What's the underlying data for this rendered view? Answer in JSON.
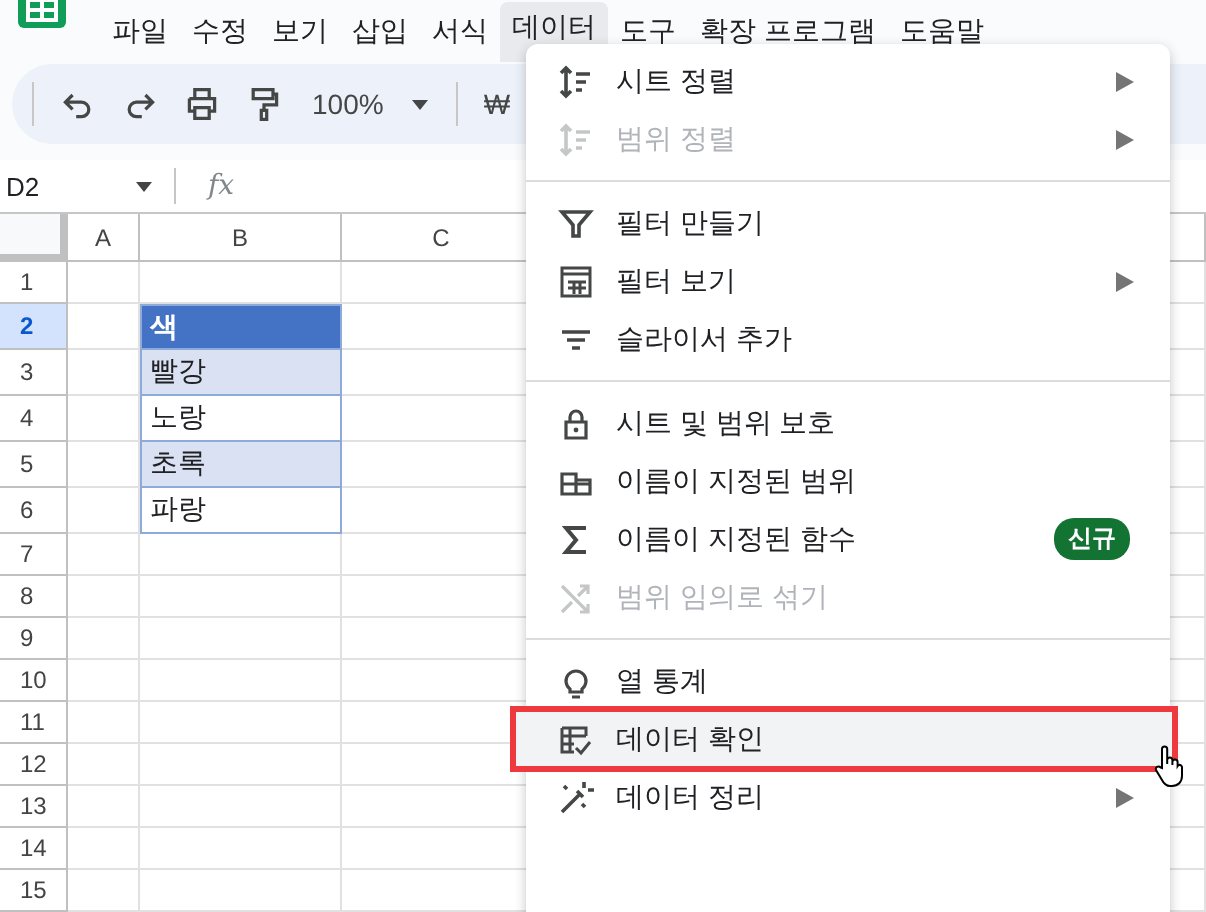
{
  "menu_bar": {
    "items": [
      {
        "label": "파일",
        "selected": false
      },
      {
        "label": "수정",
        "selected": false
      },
      {
        "label": "보기",
        "selected": false
      },
      {
        "label": "삽입",
        "selected": false
      },
      {
        "label": "서식",
        "selected": false
      },
      {
        "label": "데이터",
        "selected": true
      },
      {
        "label": "도구",
        "selected": false
      },
      {
        "label": "확장 프로그램",
        "selected": false
      },
      {
        "label": "도움말",
        "selected": false
      }
    ]
  },
  "toolbar": {
    "zoom": "100%",
    "currency": "₩"
  },
  "formula_bar": {
    "cell_ref": "D2",
    "fx": "fx"
  },
  "sheet": {
    "columns": [
      "A",
      "B",
      "C"
    ],
    "rows": [
      {
        "header": "1",
        "selected": false
      },
      {
        "header": "2",
        "selected": true,
        "b": {
          "text": "색",
          "kind": "header"
        }
      },
      {
        "header": "3",
        "selected": false,
        "b": {
          "text": "빨강",
          "kind": "band"
        }
      },
      {
        "header": "4",
        "selected": false,
        "b": {
          "text": "노랑",
          "kind": "plain"
        }
      },
      {
        "header": "5",
        "selected": false,
        "b": {
          "text": "초록",
          "kind": "band"
        }
      },
      {
        "header": "6",
        "selected": false,
        "b": {
          "text": "파랑",
          "kind": "plain"
        }
      },
      {
        "header": "7",
        "selected": false
      },
      {
        "header": "8",
        "selected": false
      },
      {
        "header": "9",
        "selected": false
      },
      {
        "header": "10",
        "selected": false
      },
      {
        "header": "11",
        "selected": false
      },
      {
        "header": "12",
        "selected": false
      },
      {
        "header": "13",
        "selected": false
      },
      {
        "header": "14",
        "selected": false
      },
      {
        "header": "15",
        "selected": false
      }
    ]
  },
  "data_menu": {
    "sections": [
      {
        "items": [
          {
            "label": "시트 정렬",
            "disabled": false,
            "submenu": true,
            "highlighted": false
          },
          {
            "label": "범위 정렬",
            "disabled": true,
            "submenu": true,
            "highlighted": false
          }
        ]
      },
      {
        "items": [
          {
            "label": "필터 만들기",
            "disabled": false,
            "submenu": false,
            "highlighted": false
          },
          {
            "label": "필터 보기",
            "disabled": false,
            "submenu": true,
            "highlighted": false
          },
          {
            "label": "슬라이서 추가",
            "disabled": false,
            "submenu": false,
            "highlighted": false
          }
        ]
      },
      {
        "items": [
          {
            "label": "시트 및 범위 보호",
            "disabled": false,
            "submenu": false,
            "highlighted": false
          },
          {
            "label": "이름이 지정된 범위",
            "disabled": false,
            "submenu": false,
            "highlighted": false
          },
          {
            "label": "이름이 지정된 함수",
            "disabled": false,
            "submenu": false,
            "highlighted": false,
            "badge": "신규"
          },
          {
            "label": "범위 임의로 섞기",
            "disabled": true,
            "submenu": false,
            "highlighted": false
          }
        ]
      },
      {
        "items": [
          {
            "label": "열 통계",
            "disabled": false,
            "submenu": false,
            "highlighted": false
          },
          {
            "label": "데이터 확인",
            "disabled": false,
            "submenu": false,
            "highlighted": true
          },
          {
            "label": "데이터 정리",
            "disabled": false,
            "submenu": true,
            "highlighted": false
          }
        ]
      }
    ]
  }
}
